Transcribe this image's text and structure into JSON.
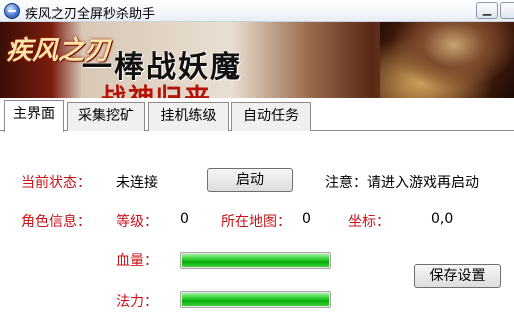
{
  "window": {
    "title": "疾风之刃全屏秒杀助手",
    "minimize_glyph": "▁",
    "close_glyph": ""
  },
  "banner": {
    "logo_text": "疾风之刃",
    "slogan": "一棒战妖魔",
    "slogan_sub": "战神归来"
  },
  "tabs": [
    {
      "label": "主界面",
      "active": true
    },
    {
      "label": "采集挖矿",
      "active": false
    },
    {
      "label": "挂机练级",
      "active": false
    },
    {
      "label": "自动任务",
      "active": false
    }
  ],
  "main": {
    "status_label": "当前状态：",
    "status_value": "未连接",
    "start_button": "启动",
    "notice": "注意：请进入游戏再启动",
    "char_info_label": "角色信息：",
    "level_label": "等级：",
    "level_value": "0",
    "map_label": "所在地图：",
    "map_value": "0",
    "coord_label": "坐标：",
    "coord_value": "0,0",
    "hp_label": "血量：",
    "hp_percent": 100,
    "mp_label": "法力：",
    "mp_percent": 100,
    "save_button": "保存设置"
  },
  "colors": {
    "label_red": "#c8141a",
    "bar_green": "#07a807"
  }
}
